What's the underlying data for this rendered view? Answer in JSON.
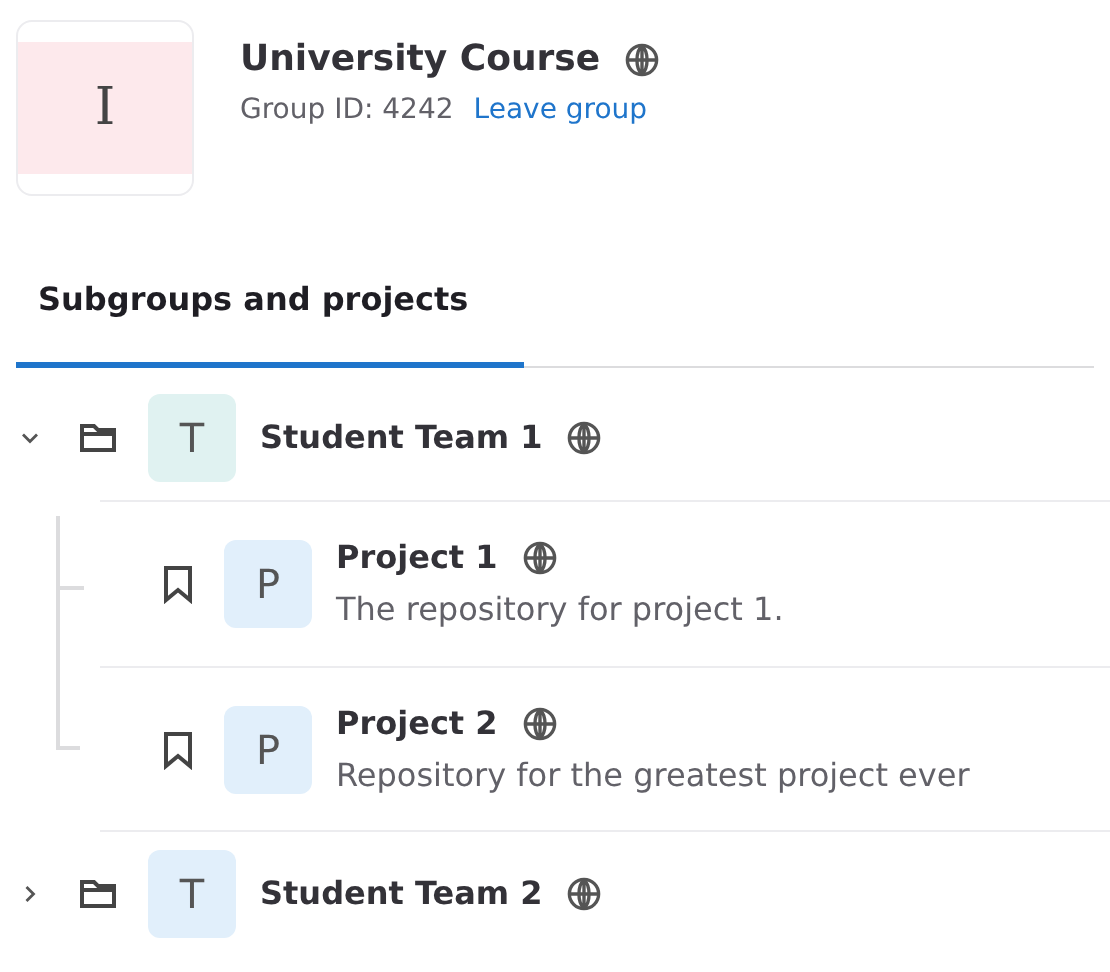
{
  "group": {
    "avatar_letter": "I",
    "name": "University Course",
    "group_id": "Group ID: 4242",
    "leave_link": "Leave group"
  },
  "tabs": [
    {
      "label": "Subgroups and projects",
      "selected": true
    }
  ],
  "items": [
    {
      "kind": "group",
      "name": "Student Team 1",
      "avatar_letter": "T",
      "color": "#e0f2f1",
      "expanded": true,
      "children": [
        {
          "kind": "project",
          "name": "Project 1",
          "avatar_letter": "P",
          "color": "#e1effb",
          "description": "The repository for project 1."
        },
        {
          "kind": "project",
          "name": "Project 2",
          "avatar_letter": "P",
          "color": "#e1effb",
          "description": "Repository for the greatest project ever"
        }
      ]
    },
    {
      "kind": "group",
      "name": "Student Team 2",
      "avatar_letter": "T",
      "color": "#e1effb",
      "expanded": false
    }
  ]
}
